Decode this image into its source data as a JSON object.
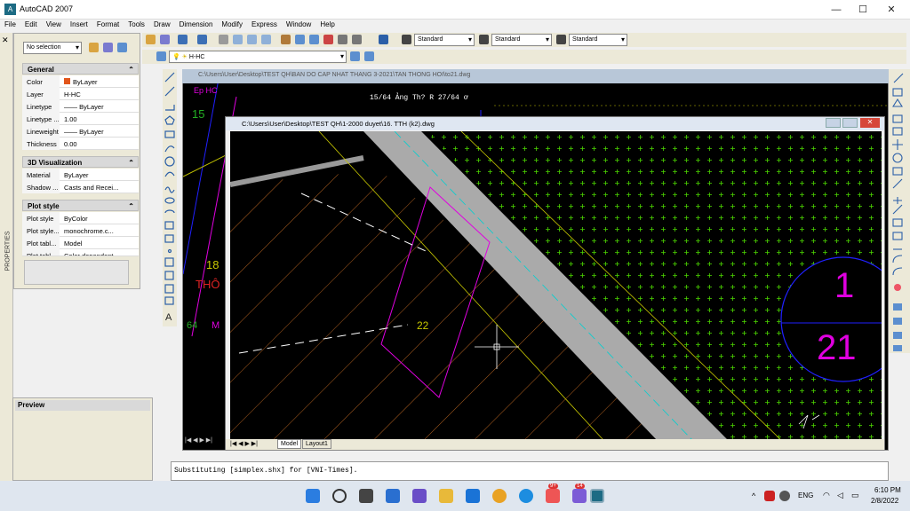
{
  "window": {
    "title": "AutoCAD 2007",
    "min": "—",
    "max": "☐",
    "close": "✕"
  },
  "menu": [
    "File",
    "Edit",
    "View",
    "Insert",
    "Format",
    "Tools",
    "Draw",
    "Dimension",
    "Modify",
    "Express",
    "Window",
    "Help"
  ],
  "toolbar": {
    "text_style": "Standard",
    "dim_style": "Standard",
    "table_style": "Standard",
    "layer": "H-HC"
  },
  "properties": {
    "panel_label": "PROPERTIES",
    "selection": "No selection",
    "sections": [
      {
        "title": "General",
        "rows": [
          [
            "Color",
            "ByLayer"
          ],
          [
            "Layer",
            "H-HC"
          ],
          [
            "Linetype",
            "—— ByLayer"
          ],
          [
            "Linetype ...",
            "1.00"
          ],
          [
            "Lineweight",
            "—— ByLayer"
          ],
          [
            "Thickness",
            "0.00"
          ]
        ]
      },
      {
        "title": "3D Visualization",
        "rows": [
          [
            "Material",
            "ByLayer"
          ],
          [
            "Shadow ...",
            "Casts and Recei..."
          ]
        ]
      },
      {
        "title": "Plot style",
        "rows": [
          [
            "Plot style",
            "ByColor"
          ],
          [
            "Plot style...",
            "monochrome.c..."
          ],
          [
            "Plot tabl...",
            "Model"
          ],
          [
            "Plot tabl",
            "Color dependent"
          ]
        ]
      }
    ],
    "color_swatch": "#e2561b"
  },
  "preview": {
    "title": "Preview"
  },
  "bg_drawing": {
    "path": "C:\\Users\\User\\Desktop\\TEST QH\\BAN DO CAP NHAT THANG 3-2021\\TAN THONG HOI\\to21.dwg",
    "text_top": "15/64 Ảng Th? R 27/64 ơ",
    "text_15": "15",
    "text_18": "18",
    "text_tho": "THÔ",
    "text_64": "64",
    "text_ep": "Ep HC",
    "text_m": "M"
  },
  "child_drawing": {
    "path": "C:\\Users\\User\\Desktop\\TEST QH\\1-2000 duyet\\16. TTH (k2).dwg",
    "label_22": "22",
    "circle_top": "1",
    "circle_bottom": "21",
    "tab_model": "Model",
    "tab_layout": "Layout1"
  },
  "command_line": "Substituting [simplex.shx] for [VNI-Times].",
  "taskbar": {
    "lang": "ENG",
    "time": "6:10 PM",
    "date": "2/8/2022",
    "badge1": "9+",
    "badge2": "14"
  },
  "colors": {
    "accent_yellow": "#c8c800",
    "magenta": "#e000e0",
    "blue": "#2020ff",
    "green_cross": "#4ad400"
  }
}
